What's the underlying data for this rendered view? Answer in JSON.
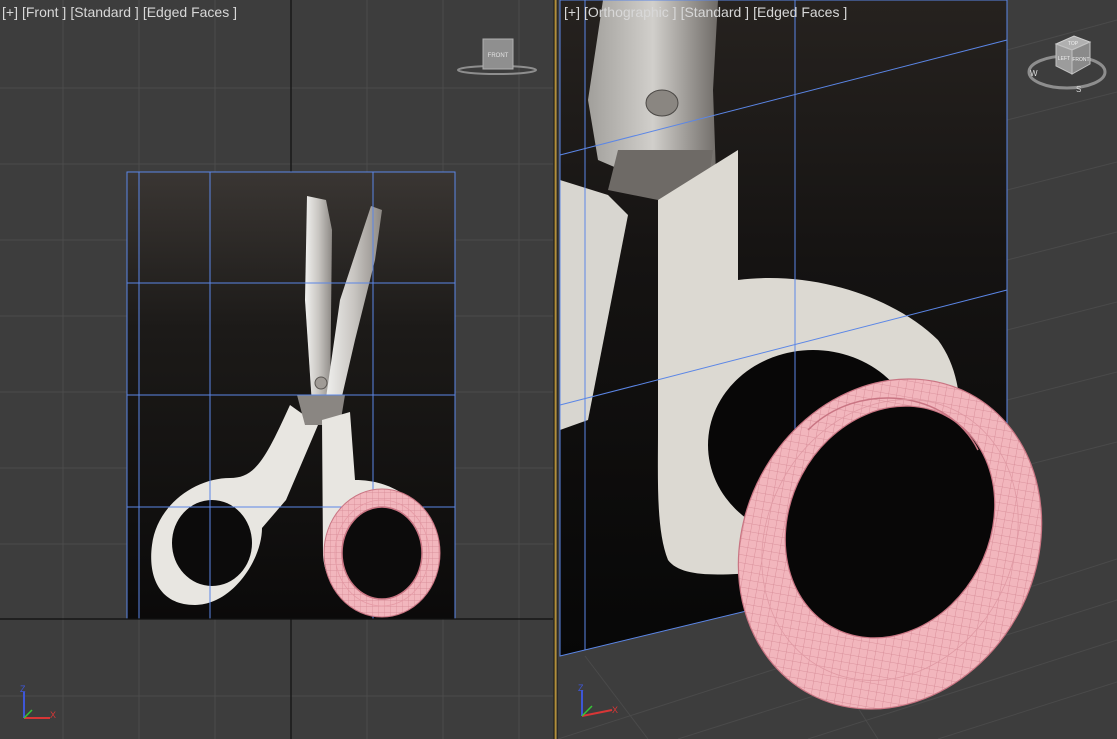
{
  "left_viewport": {
    "labels": [
      "[+]",
      "[Front ]",
      "[Standard ]",
      "[Edged Faces ]"
    ],
    "viewcube_face": "FRONT",
    "viewcube_icon": "viewcube-front-icon",
    "axis_labels": {
      "up": "Z",
      "right": "X"
    }
  },
  "right_viewport": {
    "labels": [
      "[+]",
      "[Orthographic ]",
      "[Standard ]",
      "[Edged Faces ]"
    ],
    "viewcube_faces": {
      "top": "TOP",
      "front": "FRONT",
      "left": "LEFT"
    },
    "compass": {
      "w": "W",
      "s": "S"
    },
    "viewcube_icon": "viewcube-orthographic-icon",
    "axis_labels": {
      "up": "Z",
      "right": "X"
    }
  },
  "colors": {
    "viewport_bg": "#3d3d3d",
    "grid": "#4b4b4b",
    "grid_axis": "#111111",
    "plane_edge": "#5b86e6",
    "torus": "#f2b6bd",
    "torus_wire": "#d98a94",
    "active_border": "#c8a14a"
  }
}
